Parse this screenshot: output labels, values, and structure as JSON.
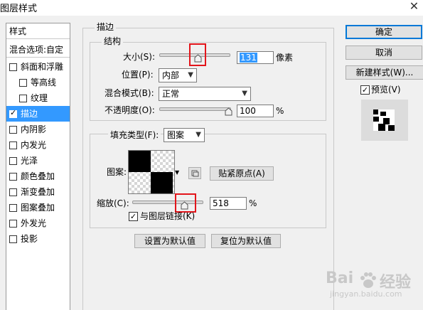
{
  "window": {
    "title": "图层样式"
  },
  "style_list": {
    "header": "样式",
    "blend_options": "混合选项:自定",
    "items": [
      {
        "label": "斜面和浮雕",
        "checked": false
      },
      {
        "label": "等高线",
        "checked": false
      },
      {
        "label": "纹理",
        "checked": false
      },
      {
        "label": "描边",
        "checked": true
      },
      {
        "label": "内阴影",
        "checked": false
      },
      {
        "label": "内发光",
        "checked": false
      },
      {
        "label": "光泽",
        "checked": false
      },
      {
        "label": "颜色叠加",
        "checked": false
      },
      {
        "label": "渐变叠加",
        "checked": false
      },
      {
        "label": "图案叠加",
        "checked": false
      },
      {
        "label": "外发光",
        "checked": false
      },
      {
        "label": "投影",
        "checked": false
      }
    ]
  },
  "stroke": {
    "section_title": "描边",
    "structure": {
      "legend": "结构",
      "size_label": "大小(S):",
      "size_value": "131",
      "size_unit": "像素",
      "position_label": "位置(P):",
      "position_value": "内部",
      "blend_label": "混合模式(B):",
      "blend_value": "正常",
      "opacity_label": "不透明度(O):",
      "opacity_value": "100",
      "opacity_unit": "%"
    },
    "fill": {
      "fill_type_label": "填充类型(F):",
      "fill_type_value": "图案",
      "pattern_label": "图案:",
      "snap_origin_button": "贴紧原点(A)",
      "scale_label": "缩放(C):",
      "scale_value": "518",
      "scale_unit": "%",
      "link_label": "与图层链接(K)",
      "link_checked": true
    },
    "set_default_button": "设置为默认值",
    "reset_default_button": "复位为默认值"
  },
  "buttons": {
    "ok": "确定",
    "cancel": "取消",
    "new_style": "新建样式(W)...",
    "preview_label": "预览(V)",
    "preview_checked": true
  },
  "watermark": {
    "brand": "Bai",
    "sub": "经验",
    "url": "jingyan.baidu.com"
  },
  "colors": {
    "selection": "#3399ff",
    "highlight_box": "#e3151b"
  }
}
